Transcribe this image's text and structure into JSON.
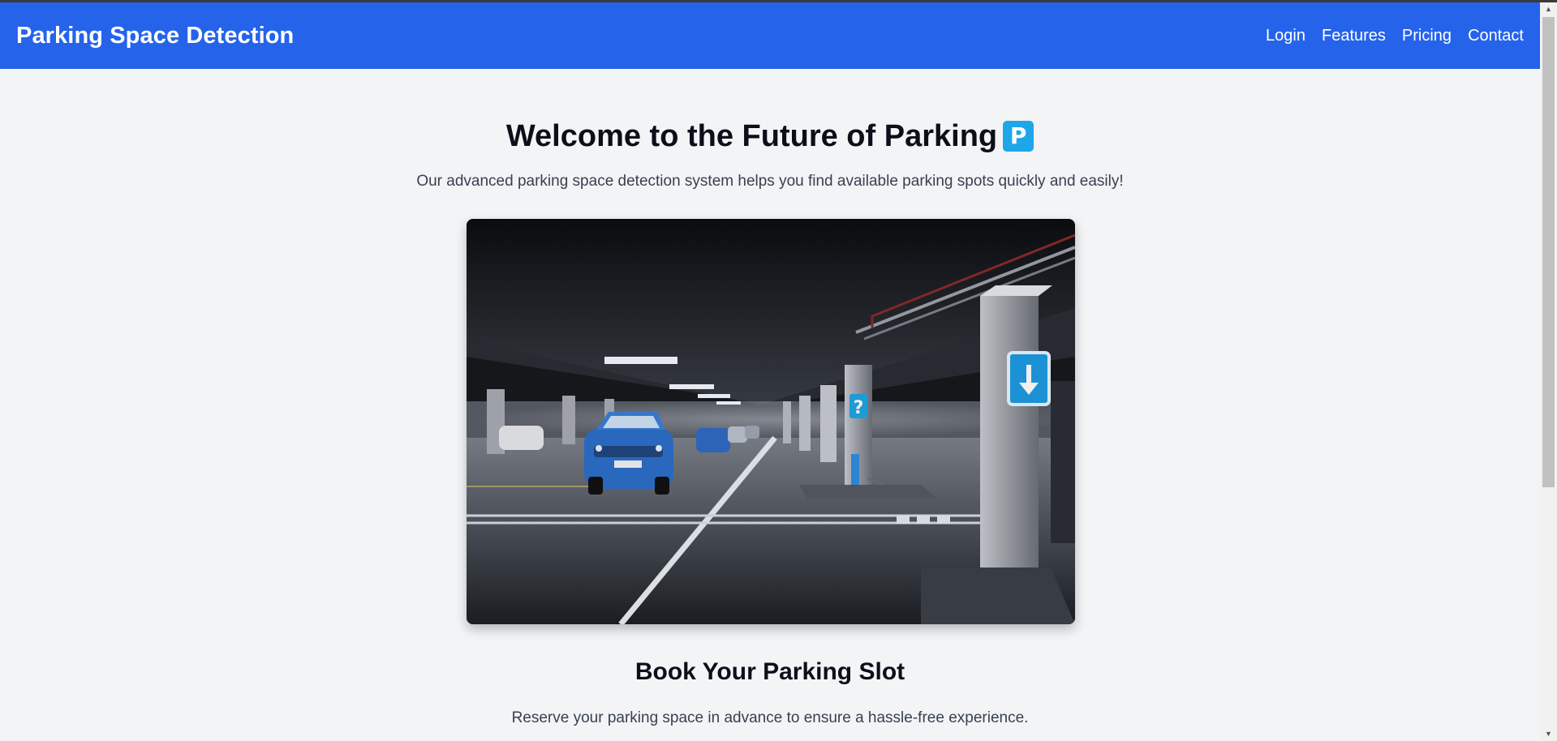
{
  "navbar": {
    "brand": "Parking Space Detection",
    "links": [
      "Login",
      "Features",
      "Pricing",
      "Contact"
    ]
  },
  "hero": {
    "title": "Welcome to the Future of Parking",
    "badge": "P",
    "subtitle": "Our advanced parking space detection system helps you find available parking spots quickly and easily!"
  },
  "booking": {
    "title": "Book Your Parking Slot",
    "subtitle": "Reserve your parking space in advance to ensure a hassle-free experience."
  },
  "colors": {
    "navbar": "#2563eb",
    "background": "#f3f4f6",
    "badge": "#1ea7e8"
  },
  "icons": {
    "scroll_up": "triangle-up-icon",
    "scroll_down": "triangle-down-icon"
  }
}
